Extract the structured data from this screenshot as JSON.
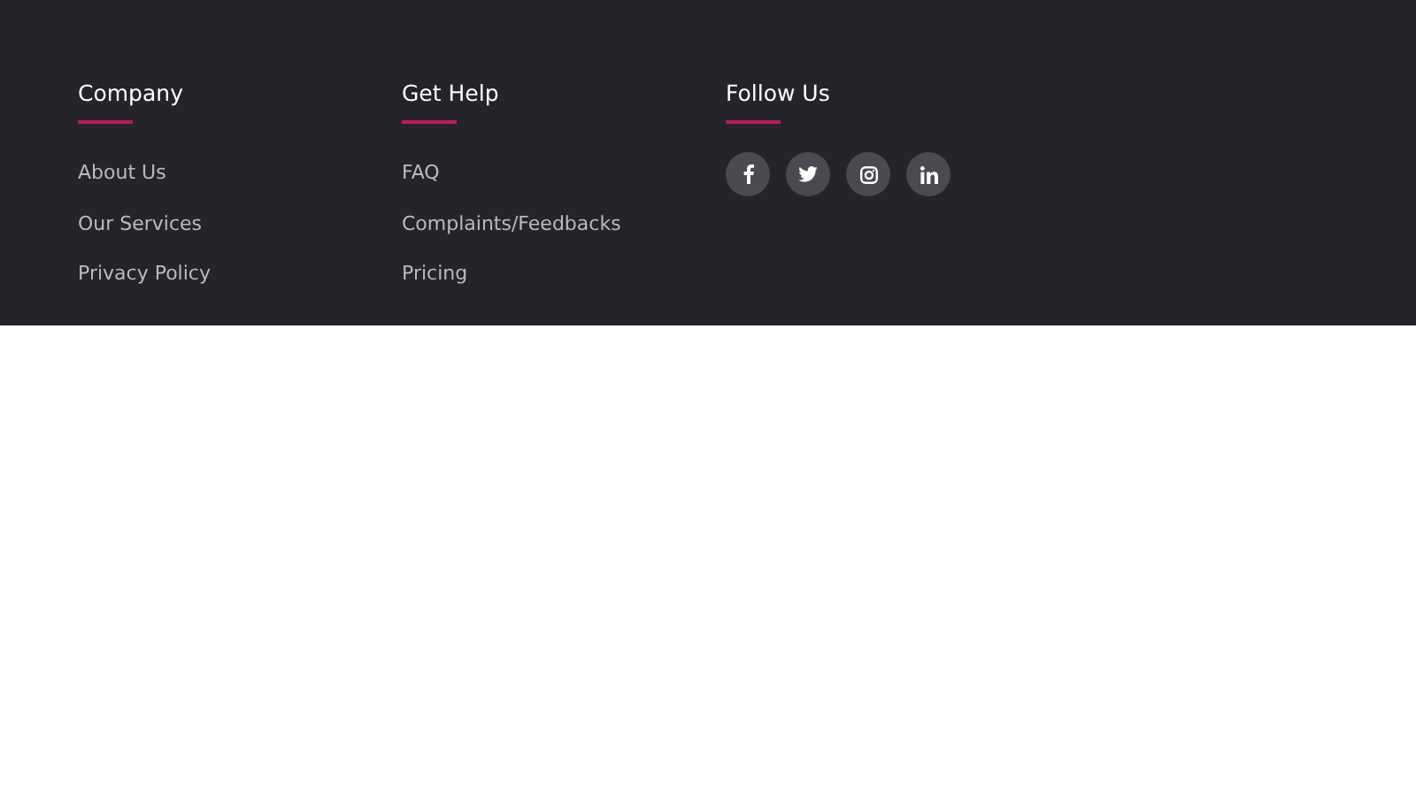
{
  "footer": {
    "columns": [
      {
        "heading": "Company",
        "links": [
          "About Us",
          "Our Services",
          "Privacy Policy"
        ]
      },
      {
        "heading": "Get Help",
        "links": [
          "FAQ",
          "Complaints/Feedbacks",
          "Pricing"
        ]
      },
      {
        "heading": "Follow Us",
        "social": [
          {
            "kind": "facebook"
          },
          {
            "kind": "twitter"
          },
          {
            "kind": "instagram"
          },
          {
            "kind": "linkedin"
          }
        ]
      }
    ]
  }
}
